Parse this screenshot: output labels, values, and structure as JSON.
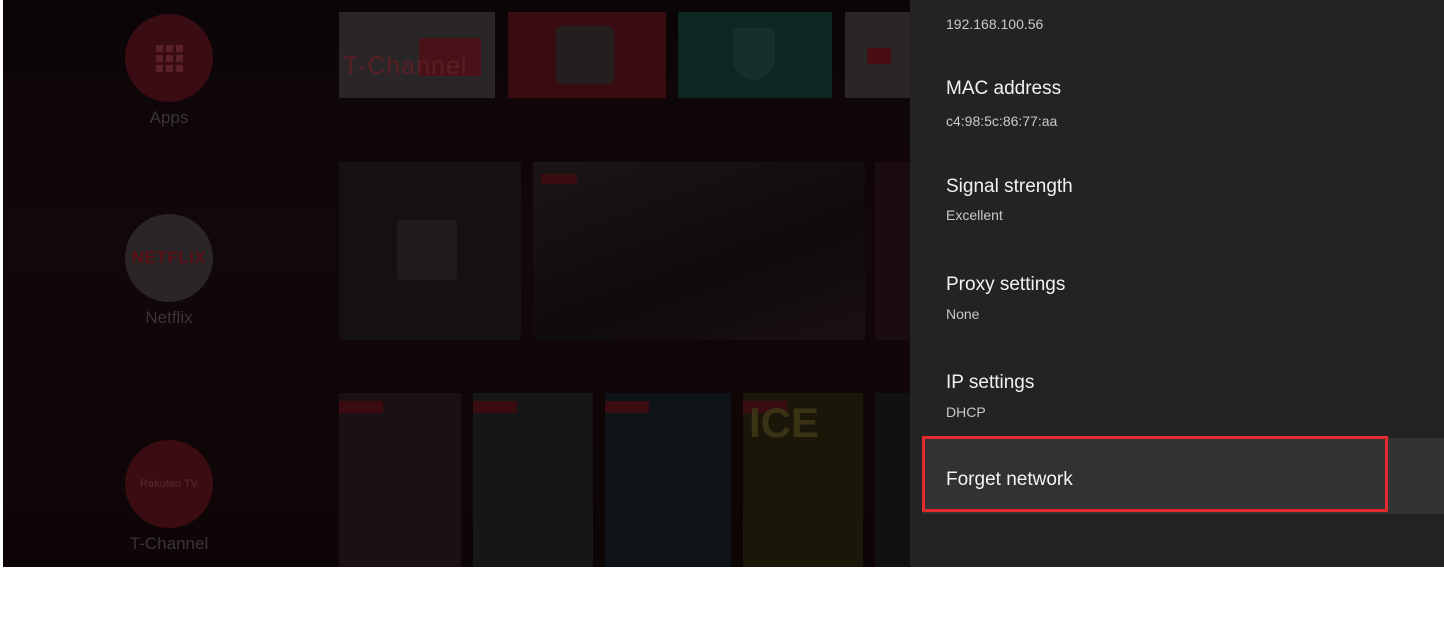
{
  "home": {
    "nav": [
      {
        "label": "Apps",
        "icon": "apps-grid-icon"
      },
      {
        "label": "Netflix",
        "logo": "NETFLIX"
      },
      {
        "label": "T-Channel",
        "logo": "Rakuten TV"
      }
    ],
    "tiles": {
      "t_channel_logo": "T-Channel",
      "kids_label": "KIDS"
    },
    "posters": {
      "p4_title": "ICE"
    }
  },
  "settings": {
    "ip_address_value": "192.168.100.56",
    "rows": [
      {
        "title": "MAC address",
        "value": "c4:98:5c:86:77:aa"
      },
      {
        "title": "Signal strength",
        "value": "Excellent"
      },
      {
        "title": "Proxy settings",
        "value": "None"
      },
      {
        "title": "IP settings",
        "value": "DHCP"
      }
    ],
    "forget_network": "Forget network"
  },
  "colors": {
    "panel_bg": "#232224",
    "highlight_border": "#e22b2b",
    "focused_row_bg": "#323134"
  }
}
